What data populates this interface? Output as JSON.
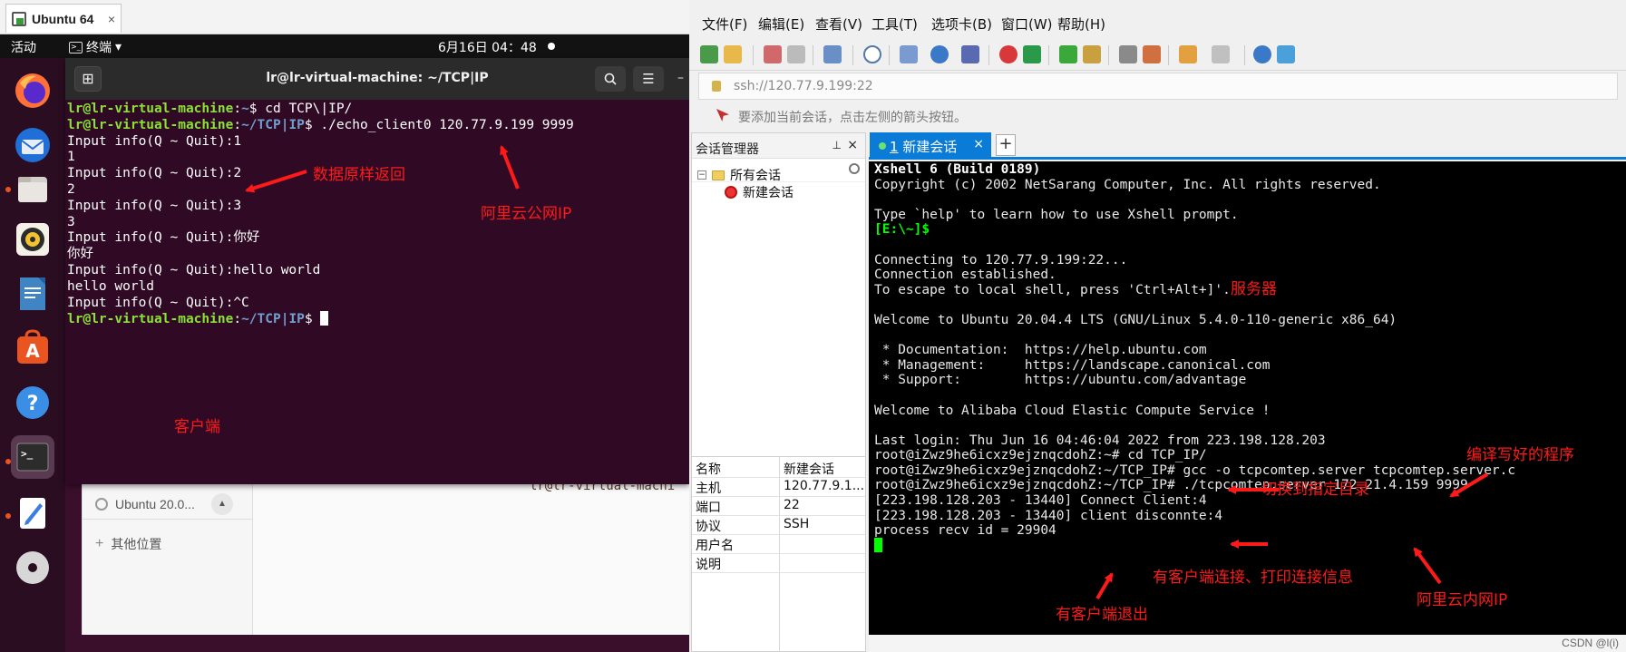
{
  "vm": {
    "tab_title": "Ubuntu 64",
    "tab_close": "×",
    "topbar": {
      "activities": "活动",
      "app_name": "终端",
      "app_menu_caret": "▾",
      "clock": "6月16日  04：48"
    },
    "terminal": {
      "title": "lr@lr-virtual-machine: ~/TCP|IP",
      "lines": [
        {
          "user": "lr@lr-virtual-machine",
          "path": "~",
          "cmd": "$ cd TCP\\|IP/"
        },
        {
          "user": "lr@lr-virtual-machine",
          "path": "~/TCP|IP",
          "cmd": "$ ./echo_client0 120.77.9.199 9999"
        },
        {
          "text": "Input info(Q ~ Quit):1"
        },
        {
          "text": "1"
        },
        {
          "text": "Input info(Q ~ Quit):2"
        },
        {
          "text": "2"
        },
        {
          "text": "Input info(Q ~ Quit):3"
        },
        {
          "text": "3"
        },
        {
          "text": "Input info(Q ~ Quit):你好"
        },
        {
          "text": "你好"
        },
        {
          "text": "Input info(Q ~ Quit):hello world"
        },
        {
          "text": "hello world"
        },
        {
          "text": "Input info(Q ~ Quit):^C"
        },
        {
          "user": "lr@lr-virtual-machine",
          "path": "~/TCP|IP",
          "cmd": "$ "
        }
      ]
    },
    "files": {
      "drive": "Ubuntu 20.0...",
      "other_locations": "其他位置"
    },
    "ghost_prompt": "lr@lr-virtual-machi"
  },
  "annotations": {
    "echo": "数据原样返回",
    "aliyun_public_ip": "阿里云公网IP",
    "client": "客户端",
    "server": "服务器",
    "compiled": "编译写好的程序",
    "cd_dir": "切换到指定目录",
    "client_connect": "有客户端连接、打印连接信息",
    "aliyun_private_ip": "阿里云内网IP",
    "client_exit": "有客户端退出"
  },
  "xshell": {
    "menu": [
      "文件(F)",
      "编辑(E)",
      "查看(V)",
      "工具(T)",
      "选项卡(B)",
      "窗口(W)",
      "帮助(H)"
    ],
    "address": "ssh://120.77.9.199:22",
    "hint": "要添加当前会话，点击左侧的箭头按钮。",
    "session_manager": {
      "title": "会话管理器",
      "pin": "📌",
      "close": "×",
      "tree_root": "所有会话",
      "tree_child": "新建会话",
      "props": [
        {
          "k": "名称",
          "v": "新建会话"
        },
        {
          "k": "主机",
          "v": "120.77.9.1..."
        },
        {
          "k": "端口",
          "v": "22"
        },
        {
          "k": "协议",
          "v": "SSH"
        },
        {
          "k": "用户名",
          "v": ""
        },
        {
          "k": "说明",
          "v": ""
        }
      ]
    },
    "tab": {
      "num": "1",
      "label": "新建会话",
      "close": "×",
      "add": "+"
    },
    "terminal_lines": [
      {
        "t": "Xshell 6 (Build 0189)",
        "c": "bold"
      },
      {
        "t": "Copyright (c) 2002 NetSarang Computer, Inc. All rights reserved.",
        "c": ""
      },
      {
        "t": "",
        "c": ""
      },
      {
        "t": "Type `help' to learn how to use Xshell prompt.",
        "c": ""
      },
      {
        "t": "[E:\\~]$",
        "c": "hl"
      },
      {
        "t": "",
        "c": ""
      },
      {
        "t": "Connecting to 120.77.9.199:22...",
        "c": ""
      },
      {
        "t": "Connection established.",
        "c": ""
      },
      {
        "t": "To escape to local shell, press 'Ctrl+Alt+]'.",
        "c": ""
      },
      {
        "t": "",
        "c": ""
      },
      {
        "t": "Welcome to Ubuntu 20.04.4 LTS (GNU/Linux 5.4.0-110-generic x86_64)",
        "c": ""
      },
      {
        "t": "",
        "c": ""
      },
      {
        "t": " * Documentation:  https://help.ubuntu.com",
        "c": ""
      },
      {
        "t": " * Management:     https://landscape.canonical.com",
        "c": ""
      },
      {
        "t": " * Support:        https://ubuntu.com/advantage",
        "c": ""
      },
      {
        "t": "",
        "c": ""
      },
      {
        "t": "Welcome to Alibaba Cloud Elastic Compute Service !",
        "c": ""
      },
      {
        "t": "",
        "c": ""
      },
      {
        "t": "Last login: Thu Jun 16 04:46:04 2022 from 223.198.128.203",
        "c": ""
      },
      {
        "t": "root@iZwz9he6icxz9ejznqcdohZ:~# cd TCP_IP/",
        "c": ""
      },
      {
        "t": "root@iZwz9he6icxz9ejznqcdohZ:~/TCP_IP# gcc -o tcpcomtep.server tcpcomtep.server.c",
        "c": ""
      },
      {
        "t": "root@iZwz9he6icxz9ejznqcdohZ:~/TCP_IP# ./tcpcomtep.server 172.21.4.159 9999",
        "c": ""
      },
      {
        "t": "[223.198.128.203 - 13440] Connect Client:4",
        "c": ""
      },
      {
        "t": "[223.198.128.203 - 13440] client disconnte:4",
        "c": ""
      },
      {
        "t": "process recv id = 29904",
        "c": ""
      }
    ],
    "watermark": "CSDN @l(i)"
  },
  "colors": {
    "ubuntu_bg": "#300a24",
    "prompt_user": "#8ae234",
    "prompt_path": "#729fcf",
    "xshell_accent": "#0a7cd8",
    "annotation": "#ff1a1a"
  }
}
